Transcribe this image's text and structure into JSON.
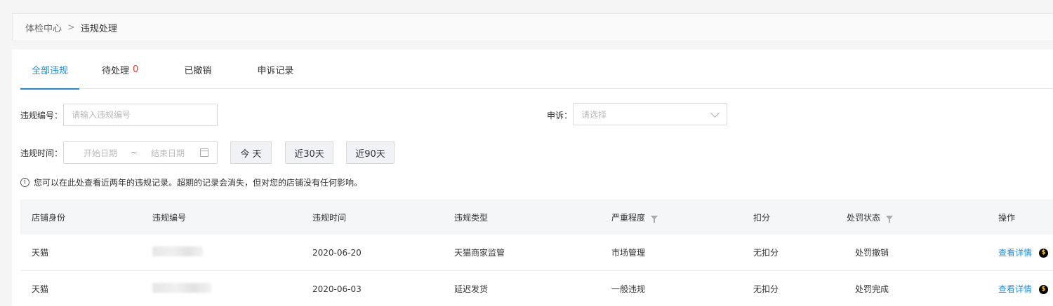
{
  "breadcrumb": {
    "root": "体检中心",
    "separator": ">",
    "current": "违规处理"
  },
  "tabs": [
    {
      "label": "全部违规",
      "active": true
    },
    {
      "label": "待处理",
      "count": "0"
    },
    {
      "label": "已撤销"
    },
    {
      "label": "申诉记录"
    }
  ],
  "filters": {
    "violation_id_label": "违规编号：",
    "violation_id_placeholder": "请输入违规编号",
    "appeal_label": "申诉：",
    "appeal_placeholder": "请选择",
    "time_label": "违规时间：",
    "start_placeholder": "开始日期",
    "range_sep": "~",
    "end_placeholder": "结束日期",
    "today": "今 天",
    "last30": "近30天",
    "last90": "近90天"
  },
  "notice": "您可以在此处查看近两年的违规记录。超期的记录会消失，但对您的店铺没有任何影响。",
  "table": {
    "headers": [
      "店铺身份",
      "违规编号",
      "违规时间",
      "违规类型",
      "严重程度",
      "扣分",
      "处罚状态",
      "操作"
    ],
    "rows": [
      {
        "identity": "天猫",
        "time": "2020-06-20",
        "type": "天猫商家监管",
        "severity": "市场管理",
        "points": "无扣分",
        "status": "处罚撤销",
        "action": "查看详情"
      },
      {
        "identity": "天猫",
        "time": "2020-06-03",
        "type": "延迟发货",
        "severity": "一般违规",
        "points": "无扣分",
        "status": "处罚完成",
        "action": "查看详情"
      }
    ]
  },
  "colors": {
    "accent": "#1a8fe0",
    "count": "#f0362b"
  },
  "icons": [
    "info-icon",
    "filter-icon",
    "chevron-down-icon",
    "calendar-icon",
    "coin-icon"
  ]
}
